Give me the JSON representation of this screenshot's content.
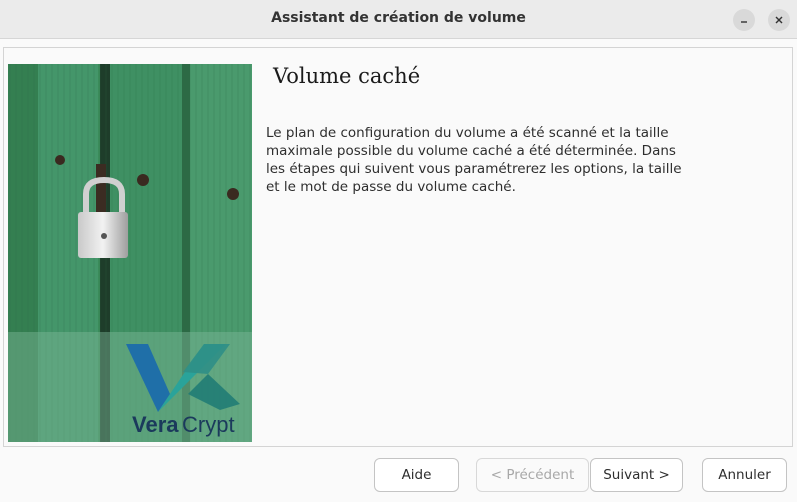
{
  "window": {
    "title": "Assistant de création de volume",
    "minimize_icon": "minimize-icon",
    "close_icon": "close-icon"
  },
  "page": {
    "heading": "Volume caché",
    "description": "Le plan de configuration du volume a été scanné et la taille maximale possible du volume caché a été déterminée. Dans les étapes qui suivent vous paramétrerez les options, la taille et le mot de passe du volume caché."
  },
  "banner": {
    "brand_left": "Vera",
    "brand_right": "Crypt",
    "colors": {
      "door_green": "#3c8c5c",
      "logo_blue": "#1f6fa8",
      "logo_teal": "#2aa39a"
    }
  },
  "buttons": {
    "help": "Aide",
    "previous": "< Précédent",
    "next": "Suivant >",
    "cancel": "Annuler"
  }
}
